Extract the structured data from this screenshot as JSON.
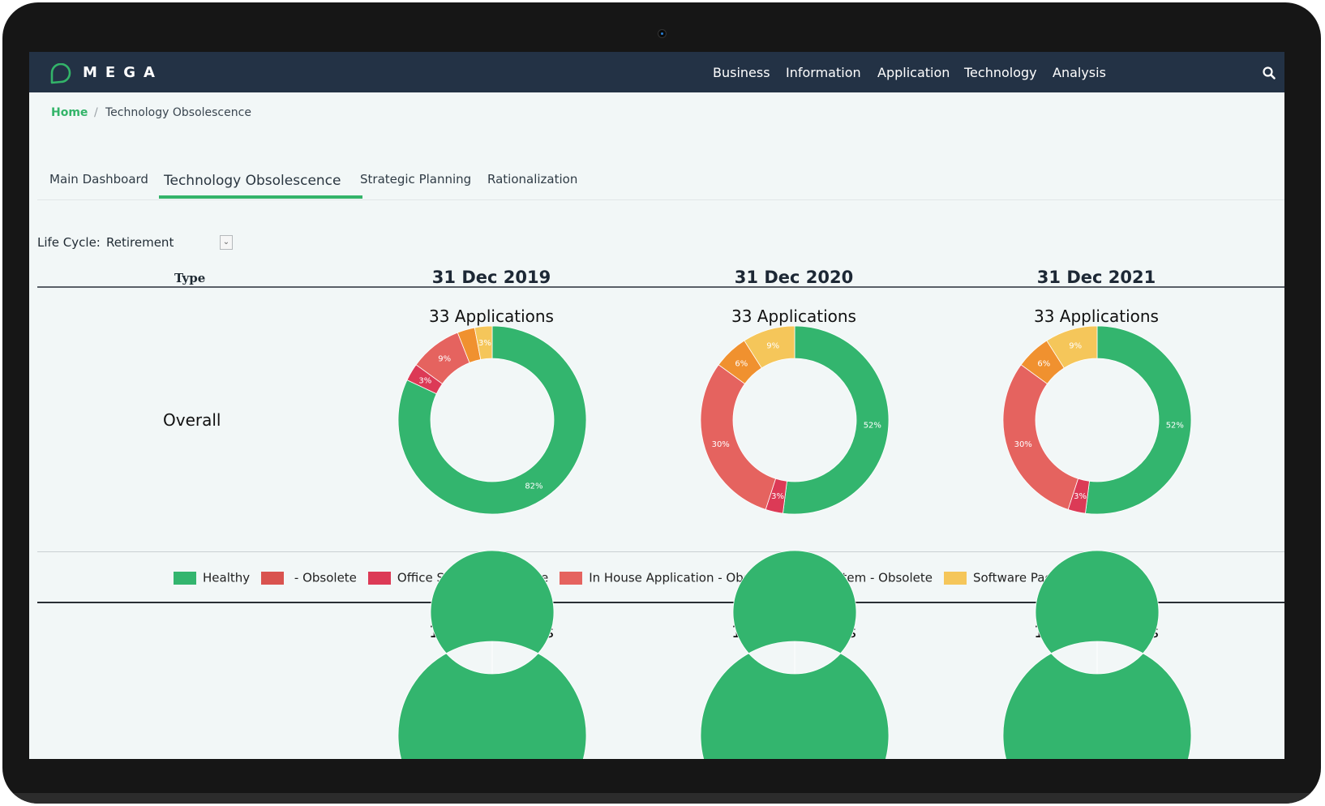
{
  "app": {
    "brand": "MEGA"
  },
  "nav": {
    "items": [
      "Business",
      "Information",
      "Application",
      "Technology",
      "Analysis"
    ]
  },
  "breadcrumb": {
    "home": "Home",
    "separator": "/",
    "current": "Technology Obsolescence"
  },
  "tabs": [
    {
      "label": "Main Dashboard",
      "active": false
    },
    {
      "label": "Technology Obsolescence",
      "active": true
    },
    {
      "label": "Strategic Planning",
      "active": false
    },
    {
      "label": "Rationalization",
      "active": false
    }
  ],
  "filter": {
    "label": "Life Cycle:",
    "value": "Retirement"
  },
  "table": {
    "type_header": "Type",
    "dates": [
      "31 Dec 2019",
      "31 Dec 2020",
      "31 Dec 2021"
    ],
    "rows": [
      {
        "label": "Overall",
        "counts": [
          "33 Applications",
          "33 Applications",
          "33 Applications"
        ]
      },
      {
        "label": "",
        "counts": [
          "12 Applications",
          "12 Applications",
          "12 Applications"
        ]
      }
    ]
  },
  "legend": [
    {
      "label": "Healthy",
      "color": "#33b56e"
    },
    {
      "label": " - Obsolete",
      "color": "#d9534f"
    },
    {
      "label": "Office System - Obsolete",
      "color": "#dc3a56"
    },
    {
      "label": "In House Application - Obsolete",
      "color": "#e5635f"
    },
    {
      "label": "System - Obsolete",
      "color": "#f0912f"
    },
    {
      "label": "Software Package - Obsolete",
      "color": "#f5c65a"
    }
  ],
  "chart_data": [
    {
      "type": "pie",
      "title": "33 Applications",
      "categories": [
        "Healthy",
        "Office System - Obsolete",
        "In House Application - Obsolete",
        "System - Obsolete",
        "Software Package - Obsolete"
      ],
      "values": [
        82,
        3,
        9,
        3,
        3
      ],
      "labels": [
        "82%",
        "3%",
        "9%",
        "",
        "3%"
      ]
    },
    {
      "type": "pie",
      "title": "33 Applications",
      "categories": [
        "Healthy",
        "Office System - Obsolete",
        "In House Application - Obsolete",
        "System - Obsolete",
        "Software Package - Obsolete"
      ],
      "values": [
        52,
        3,
        30,
        6,
        9
      ],
      "labels": [
        "52%",
        "3%",
        "30%",
        "6%",
        "9%"
      ]
    },
    {
      "type": "pie",
      "title": "33 Applications",
      "categories": [
        "Healthy",
        "Office System - Obsolete",
        "In House Application - Obsolete",
        "System - Obsolete",
        "Software Package - Obsolete"
      ],
      "values": [
        52,
        3,
        30,
        6,
        9
      ],
      "labels": [
        "52%",
        "3%",
        "30%",
        "6%",
        "9%"
      ]
    },
    {
      "type": "pie",
      "title": "12 Applications",
      "categories": [
        "Healthy"
      ],
      "values": [
        100
      ],
      "labels": [
        ""
      ]
    },
    {
      "type": "pie",
      "title": "12 Applications",
      "categories": [
        "Healthy"
      ],
      "values": [
        100
      ],
      "labels": [
        ""
      ]
    },
    {
      "type": "pie",
      "title": "12 Applications",
      "categories": [
        "Healthy"
      ],
      "values": [
        100
      ],
      "labels": [
        ""
      ]
    }
  ]
}
